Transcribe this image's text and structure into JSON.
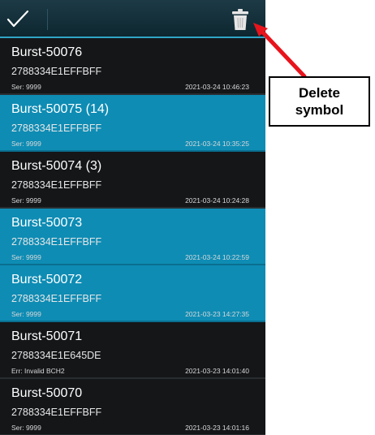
{
  "toolbar": {
    "confirm_icon": "check-icon",
    "delete_icon": "trash-icon"
  },
  "items": [
    {
      "title": "Burst-50076",
      "hex": "2788334E1EFFBFF",
      "status": "Ser: 9999",
      "timestamp": "2021-03-24 10:46:23",
      "selected": false
    },
    {
      "title": "Burst-50075 (14)",
      "hex": "2788334E1EFFBFF",
      "status": "Ser: 9999",
      "timestamp": "2021-03-24 10:35:25",
      "selected": true
    },
    {
      "title": "Burst-50074 (3)",
      "hex": "2788334E1EFFBFF",
      "status": "Ser: 9999",
      "timestamp": "2021-03-24 10:24:28",
      "selected": false
    },
    {
      "title": "Burst-50073",
      "hex": "2788334E1EFFBFF",
      "status": "Ser: 9999",
      "timestamp": "2021-03-24 10:22:59",
      "selected": true
    },
    {
      "title": "Burst-50072",
      "hex": "2788334E1EFFBFF",
      "status": "Ser: 9999",
      "timestamp": "2021-03-23 14:27:35",
      "selected": true
    },
    {
      "title": "Burst-50071",
      "hex": "2788334E1E645DE",
      "status": "Err: Invalid BCH2",
      "timestamp": "2021-03-23 14:01:40",
      "selected": false
    },
    {
      "title": "Burst-50070",
      "hex": "2788334E1EFFBFF",
      "status": "Ser: 9999",
      "timestamp": "2021-03-23 14:01:16",
      "selected": false
    }
  ],
  "annotation": {
    "text": "Delete\nsymbol",
    "arrow_color": "#e8141c"
  },
  "colors": {
    "selected_bg": "#0e8cb4",
    "dark_bg": "#141618",
    "accent": "#2fa6c7"
  }
}
